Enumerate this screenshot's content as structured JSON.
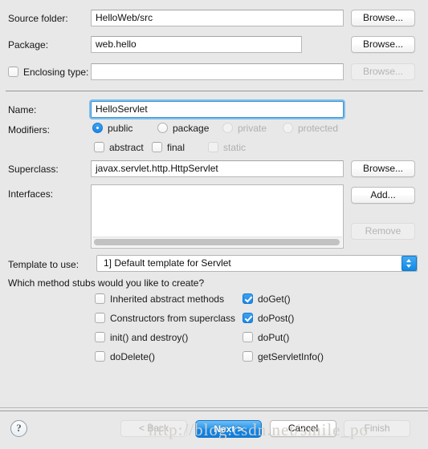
{
  "form": {
    "source_folder": {
      "label": "Source folder:",
      "value": "HelloWeb/src",
      "browse": "Browse..."
    },
    "package": {
      "label": "Package:",
      "value": "web.hello",
      "browse": "Browse..."
    },
    "enclosing_type": {
      "label": "Enclosing type:",
      "value": "",
      "browse": "Browse...",
      "checked": false
    },
    "name": {
      "label": "Name:",
      "value": "HelloServlet"
    },
    "modifiers": {
      "label": "Modifiers:"
    },
    "superclass": {
      "label": "Superclass:",
      "value": "javax.servlet.http.HttpServlet",
      "browse": "Browse..."
    },
    "interfaces": {
      "label": "Interfaces:",
      "add": "Add...",
      "remove": "Remove"
    },
    "template": {
      "label": "Template to use:",
      "value": "1] Default template for Servlet"
    }
  },
  "access_modifiers": [
    {
      "label": "public",
      "selected": true,
      "enabled": true
    },
    {
      "label": "package",
      "selected": false,
      "enabled": true
    },
    {
      "label": "private",
      "selected": false,
      "enabled": false
    },
    {
      "label": "protected",
      "selected": false,
      "enabled": false
    }
  ],
  "other_modifiers": [
    {
      "label": "abstract",
      "checked": false,
      "enabled": true
    },
    {
      "label": "final",
      "checked": false,
      "enabled": true
    },
    {
      "label": "static",
      "checked": false,
      "enabled": false
    }
  ],
  "stubs": {
    "question": "Which method stubs would you like to create?",
    "left": [
      {
        "label": "Inherited abstract methods",
        "checked": false
      },
      {
        "label": "Constructors from superclass",
        "checked": false
      },
      {
        "label": "init() and destroy()",
        "checked": false
      },
      {
        "label": "doDelete()",
        "checked": false
      }
    ],
    "right": [
      {
        "label": "doGet()",
        "checked": true
      },
      {
        "label": "doPost()",
        "checked": true
      },
      {
        "label": "doPut()",
        "checked": false
      },
      {
        "label": "getServletInfo()",
        "checked": false
      }
    ]
  },
  "footer": {
    "help": "?",
    "back": "< Back",
    "next": "Next >",
    "cancel": "Cancel",
    "finish": "Finish"
  },
  "watermark": "http://blog.csdn.net/smile_po",
  "colors": {
    "accent": "#1b87e8",
    "focus_ring": "#7cc0ec",
    "background": "#e8e8e8"
  }
}
